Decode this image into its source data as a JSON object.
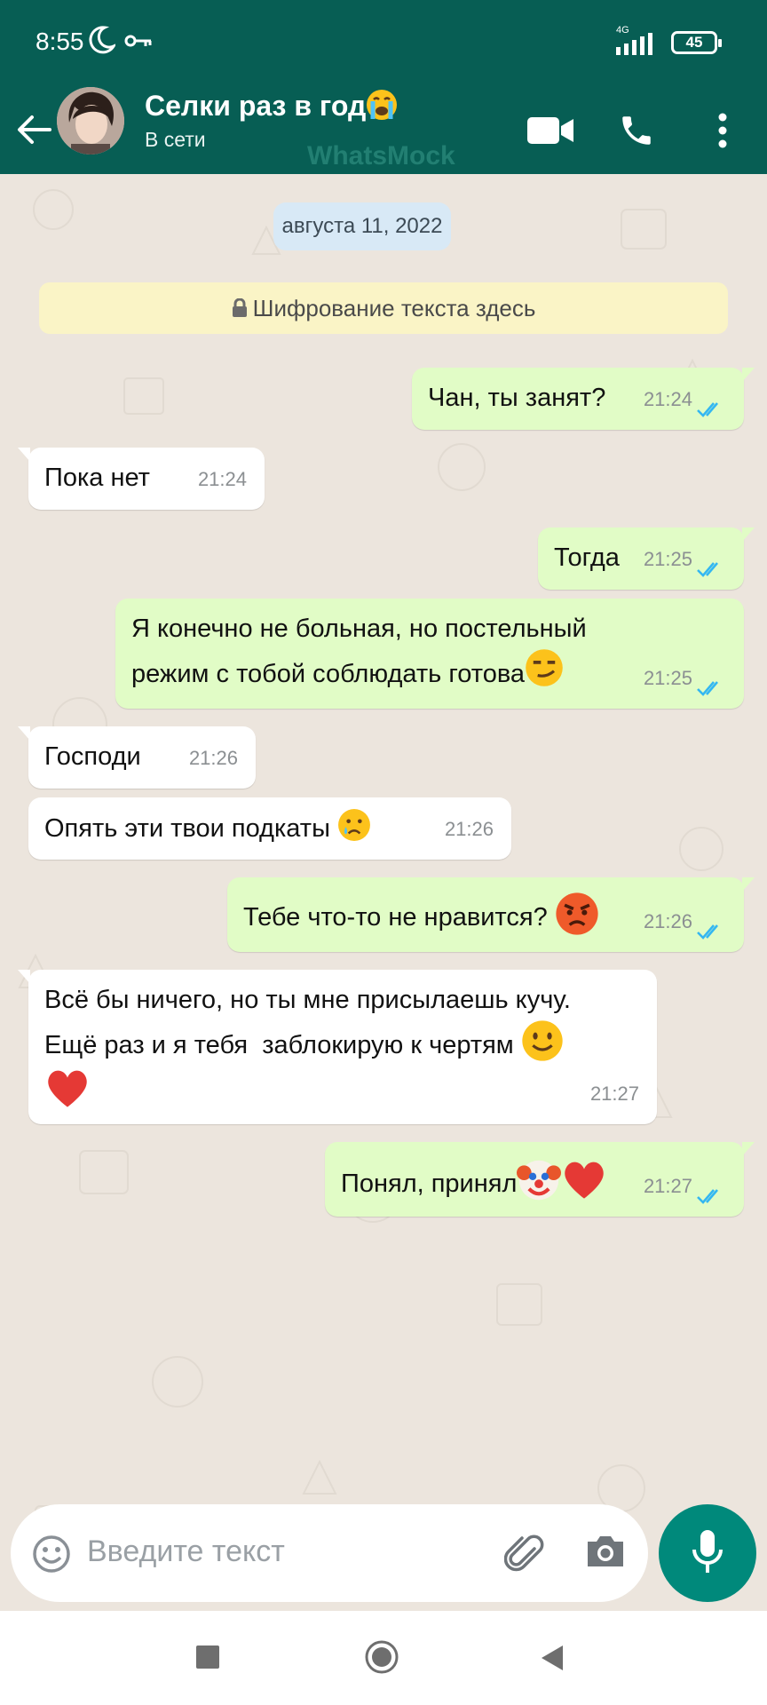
{
  "status_bar": {
    "time": "8:55",
    "network": "4G",
    "battery": "45",
    "icons": [
      "moon-icon",
      "vpn-key-icon",
      "signal-icon",
      "battery-icon"
    ]
  },
  "header": {
    "contact_name": "Селки раз в год",
    "name_emoji": "loudly-crying-face",
    "status": "В сети",
    "watermark": "WhatsMock",
    "icons": [
      "back-arrow-icon",
      "video-call-icon",
      "phone-call-icon",
      "more-options-icon"
    ],
    "color": "#075e54"
  },
  "chat": {
    "date": "августа 11, 2022",
    "encryption_notice": "Шифрование текста здесь",
    "messages": [
      {
        "direction": "out",
        "text": "Чан, ты занят?",
        "time": "21:24",
        "read": true
      },
      {
        "direction": "in",
        "text": "Пока нет",
        "time": "21:24"
      },
      {
        "direction": "out",
        "text": "Тогда",
        "time": "21:25",
        "read": true
      },
      {
        "direction": "out",
        "text": "Я конечно не больная, но постельный\nрежим с тобой соблюдать готова",
        "emoji": "smirking-face",
        "time": "21:25",
        "read": true
      },
      {
        "direction": "in",
        "text": "Господи",
        "time": "21:26"
      },
      {
        "direction": "in",
        "text": "Опять эти твои подкаты",
        "emoji": "crying-face",
        "time": "21:26"
      },
      {
        "direction": "out",
        "text": "Тебе что-то не нравится?",
        "emoji": "angry-face",
        "time": "21:26",
        "read": true
      },
      {
        "direction": "in",
        "text": "Всё бы ничего, но ты мне присылаешь кучу.\nЕщё раз и я тебя  заблокирую к чертям",
        "emoji": "slightly-smiling-face, red-heart",
        "time": "21:27"
      },
      {
        "direction": "out",
        "text": "Понял, принял",
        "emoji": "clown-face, red-heart",
        "time": "21:27",
        "read": true
      }
    ],
    "colors": {
      "incoming": "#ffffff",
      "outgoing": "#e1fcc6",
      "read_ticks": "#34b7f1"
    }
  },
  "composer": {
    "placeholder": "Введите текст",
    "icons": [
      "emoji-icon",
      "attach-icon",
      "camera-icon",
      "mic-icon"
    ],
    "accent": "#00897b"
  },
  "nav_bar": {
    "icons": [
      "recents-square-icon",
      "home-circle-icon",
      "back-triangle-icon"
    ]
  }
}
